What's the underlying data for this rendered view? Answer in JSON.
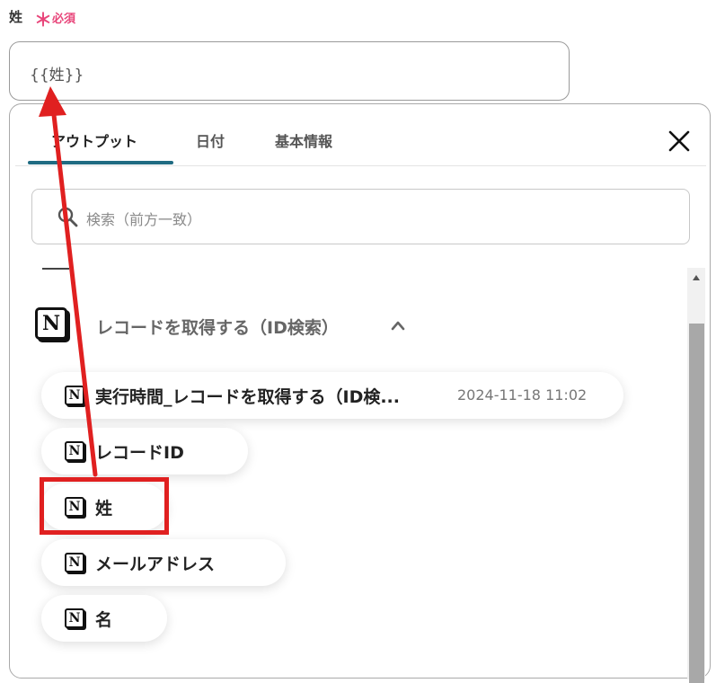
{
  "field": {
    "label": "姓",
    "required_star": "＊",
    "required_text": "必須",
    "value": "{{姓}}"
  },
  "tabs": [
    {
      "label": "アウトプット",
      "active": true
    },
    {
      "label": "日付",
      "active": false
    },
    {
      "label": "基本情報",
      "active": false
    }
  ],
  "search": {
    "placeholder": "検索（前方一致）"
  },
  "section": {
    "icon": "notion-icon",
    "icon_letter": "N",
    "title": "レコードを取得する（ID検索）",
    "expanded": true
  },
  "items": [
    {
      "label": "実行時間_レコードを取得する（ID検...",
      "meta": "2024-11-18 11:02"
    },
    {
      "label": "レコードID",
      "meta": ""
    },
    {
      "label": "姓",
      "meta": ""
    },
    {
      "label": "メールアドレス",
      "meta": ""
    },
    {
      "label": "名",
      "meta": ""
    }
  ],
  "colors": {
    "accent": "#1f6b82",
    "required": "#e8457a",
    "annotation": "#e02020"
  }
}
